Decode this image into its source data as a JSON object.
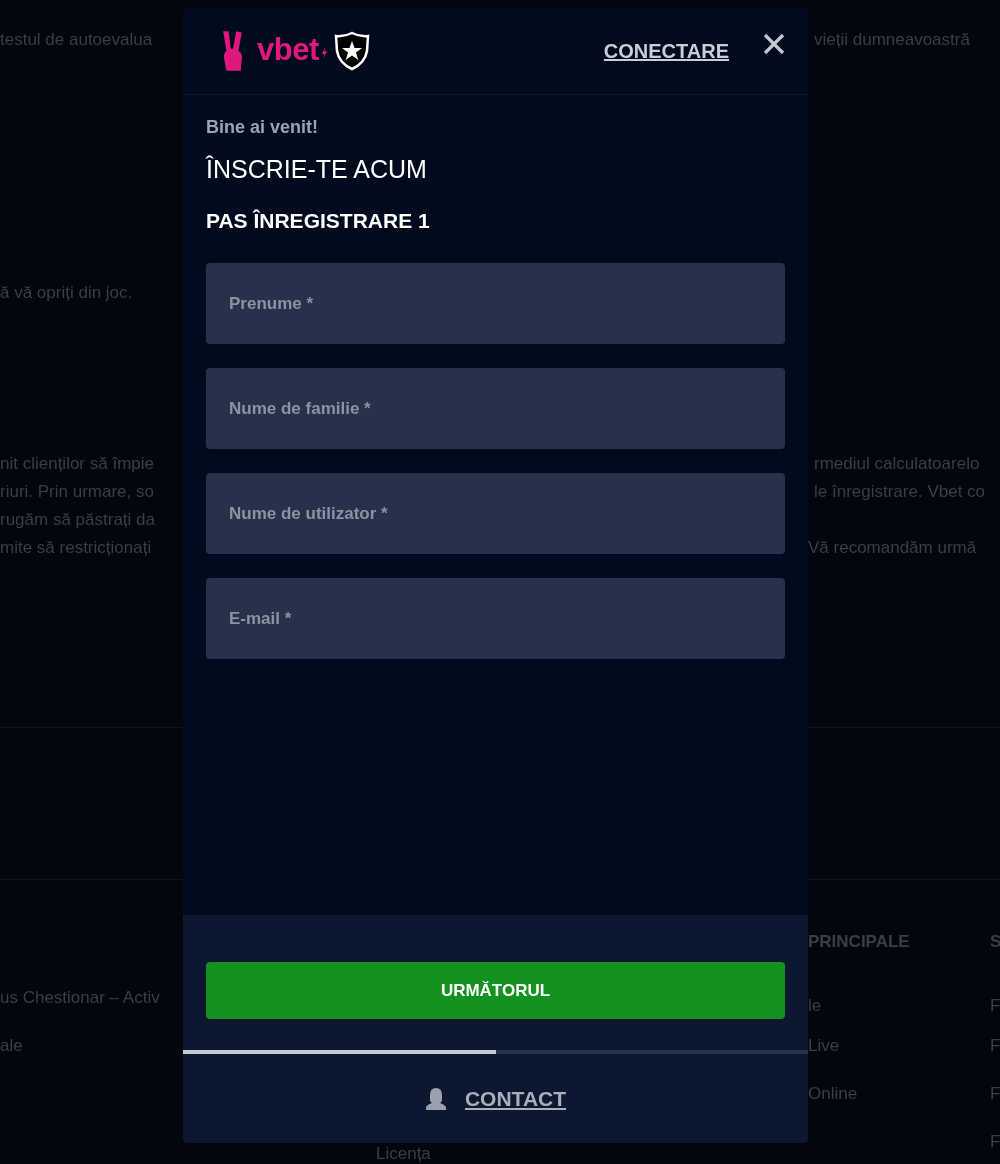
{
  "background": {
    "left_lines": [
      "testul de autoevalua",
      "ă vă opriți din joc.",
      "nit clienților să împie",
      "riuri. Prin urmare, so",
      "rugăm să păstrați da",
      "mite să restricționați"
    ],
    "right_lines": [
      "vieții dumneavoastră",
      "rmediul calculatoarelo",
      "le înregistrare. Vbet co",
      "Vă recomandăm urmă"
    ],
    "footer_columns": [
      {
        "links": [
          "us Chestionar – Activ",
          "ale"
        ]
      },
      {
        "links": [
          "Licența"
        ]
      },
      {
        "heading": "PRINCIPALE",
        "links": [
          "le",
          "Live",
          "Online"
        ]
      },
      {
        "heading": "S",
        "links": [
          "F",
          "F",
          "F",
          "F"
        ]
      }
    ]
  },
  "modal": {
    "brand": "vbet",
    "login_link": "CONECTARE",
    "greeting": "Bine ai venit!",
    "title": "ÎNSCRIE-TE ACUM",
    "step": "PAS ÎNREGISTRARE 1",
    "fields": [
      {
        "placeholder": "Prenume *"
      },
      {
        "placeholder": "Nume de familie *"
      },
      {
        "placeholder": "Nume de utilizator *"
      },
      {
        "placeholder": "E-mail *"
      }
    ],
    "next_button": "URMĂTORUL",
    "progress": {
      "level": 0.5
    },
    "contact_link": "CONTACT"
  }
}
